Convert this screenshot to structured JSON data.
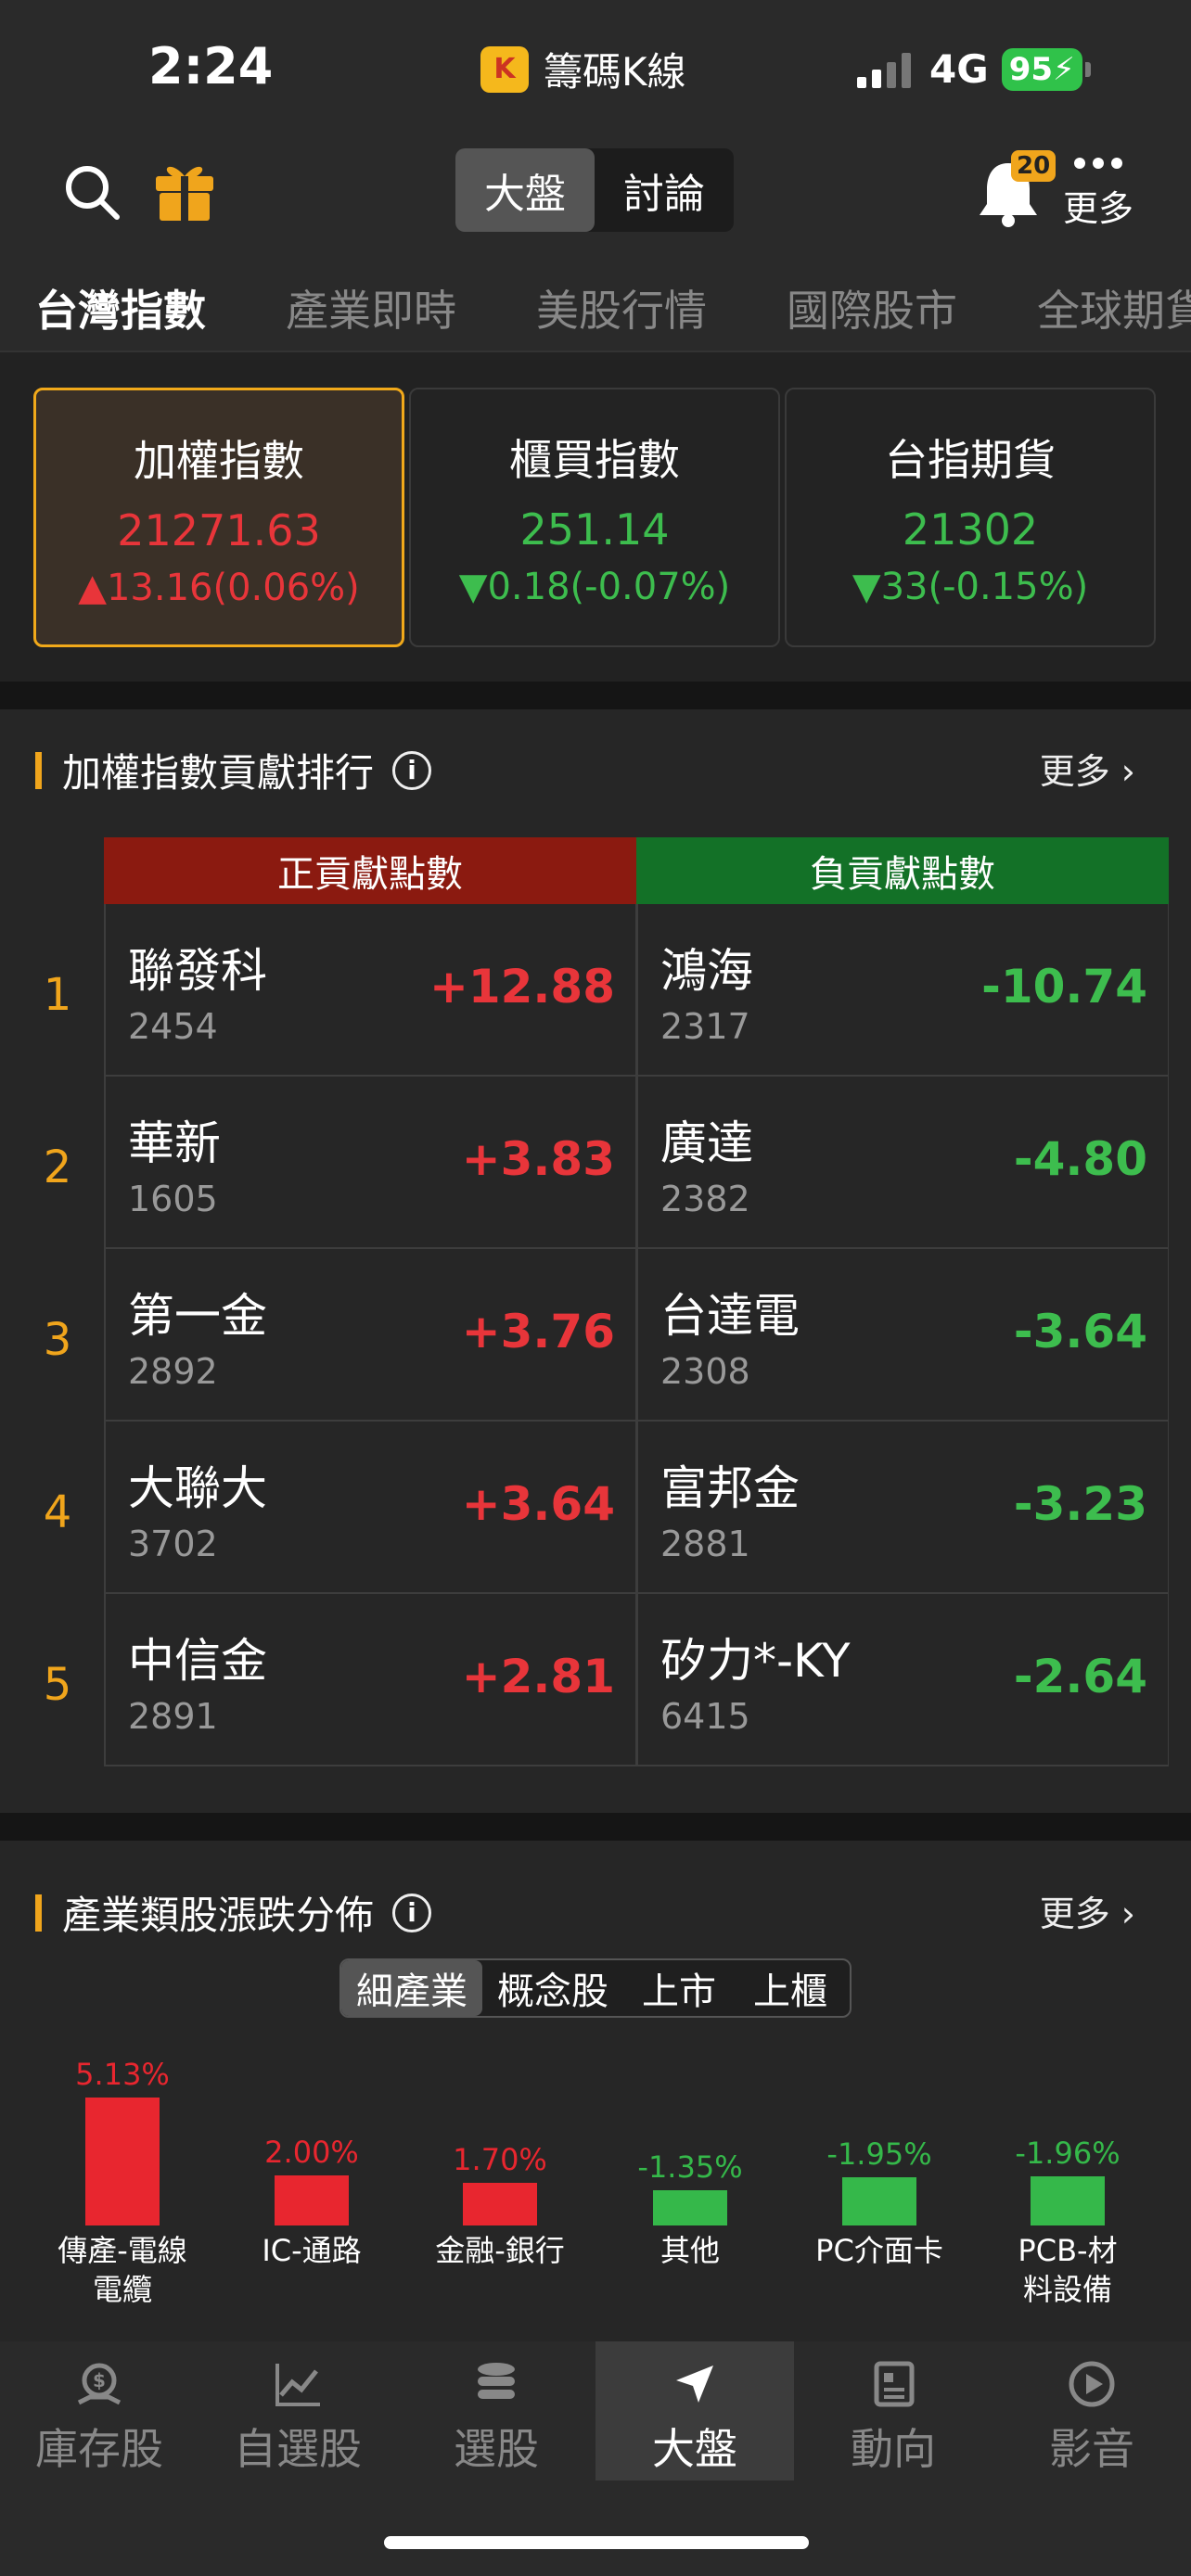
{
  "status_bar": {
    "time": "2:24",
    "app_name": "籌碼K線",
    "app_icon_text": "K",
    "network": "4G",
    "battery": "95"
  },
  "header": {
    "segments": [
      {
        "label": "大盤",
        "active": true
      },
      {
        "label": "討論",
        "active": false
      }
    ],
    "notification_count": "20",
    "more_label": "更多"
  },
  "tabs": [
    {
      "label": "台灣指數",
      "active": true
    },
    {
      "label": "產業即時"
    },
    {
      "label": "美股行情"
    },
    {
      "label": "國際股市"
    },
    {
      "label": "全球期貨"
    }
  ],
  "index_cards": [
    {
      "name": "加權指數",
      "value": "21271.63",
      "change": "▲13.16(0.06%)",
      "direction": "up",
      "selected": true
    },
    {
      "name": "櫃買指數",
      "value": "251.14",
      "change": "▼0.18(-0.07%)",
      "direction": "down"
    },
    {
      "name": "台指期貨",
      "value": "21302",
      "change": "▼33(-0.15%)",
      "direction": "down"
    }
  ],
  "contribution": {
    "title": "加權指數貢獻排行",
    "more": "更多",
    "positive_header": "正貢獻點數",
    "negative_header": "負貢獻點數",
    "rows": [
      {
        "rank": "1",
        "pos": {
          "name": "聯發科",
          "code": "2454",
          "value": "+12.88"
        },
        "neg": {
          "name": "鴻海",
          "code": "2317",
          "value": "-10.74"
        }
      },
      {
        "rank": "2",
        "pos": {
          "name": "華新",
          "code": "1605",
          "value": "+3.83"
        },
        "neg": {
          "name": "廣達",
          "code": "2382",
          "value": "-4.80"
        }
      },
      {
        "rank": "3",
        "pos": {
          "name": "第一金",
          "code": "2892",
          "value": "+3.76"
        },
        "neg": {
          "name": "台達電",
          "code": "2308",
          "value": "-3.64"
        }
      },
      {
        "rank": "4",
        "pos": {
          "name": "大聯大",
          "code": "3702",
          "value": "+3.64"
        },
        "neg": {
          "name": "富邦金",
          "code": "2881",
          "value": "-3.23"
        }
      },
      {
        "rank": "5",
        "pos": {
          "name": "中信金",
          "code": "2891",
          "value": "+2.81"
        },
        "neg": {
          "name": "矽力*-KY",
          "code": "6415",
          "value": "-2.64"
        }
      }
    ]
  },
  "industry": {
    "title": "產業類股漲跌分佈",
    "more": "更多",
    "filters": [
      {
        "label": "細產業",
        "active": true
      },
      {
        "label": "概念股"
      },
      {
        "label": "上市"
      },
      {
        "label": "上櫃"
      }
    ],
    "bars": [
      {
        "pct": "5.13%",
        "value": 5.13,
        "label_lines": [
          "傳產-電線",
          "電纜"
        ]
      },
      {
        "pct": "2.00%",
        "value": 2.0,
        "label_lines": [
          "IC-通路"
        ]
      },
      {
        "pct": "1.70%",
        "value": 1.7,
        "label_lines": [
          "金融-銀行"
        ]
      },
      {
        "pct": "-1.35%",
        "value": -1.35,
        "label_lines": [
          "其他"
        ]
      },
      {
        "pct": "-1.95%",
        "value": -1.95,
        "label_lines": [
          "PC介面卡"
        ]
      },
      {
        "pct": "-1.96%",
        "value": -1.96,
        "label_lines": [
          "PCB-材",
          "料設備"
        ]
      }
    ],
    "colors": {
      "up": "#e8262f",
      "down": "#35b84a"
    }
  },
  "bottom_nav": [
    {
      "label": "庫存股",
      "icon": "money-bag-icon"
    },
    {
      "label": "自選股",
      "icon": "chart-line-icon"
    },
    {
      "label": "選股",
      "icon": "database-stack-icon"
    },
    {
      "label": "大盤",
      "icon": "navigation-arrow-icon",
      "active": true
    },
    {
      "label": "動向",
      "icon": "newspaper-icon"
    },
    {
      "label": "影音",
      "icon": "play-circle-icon"
    }
  ]
}
